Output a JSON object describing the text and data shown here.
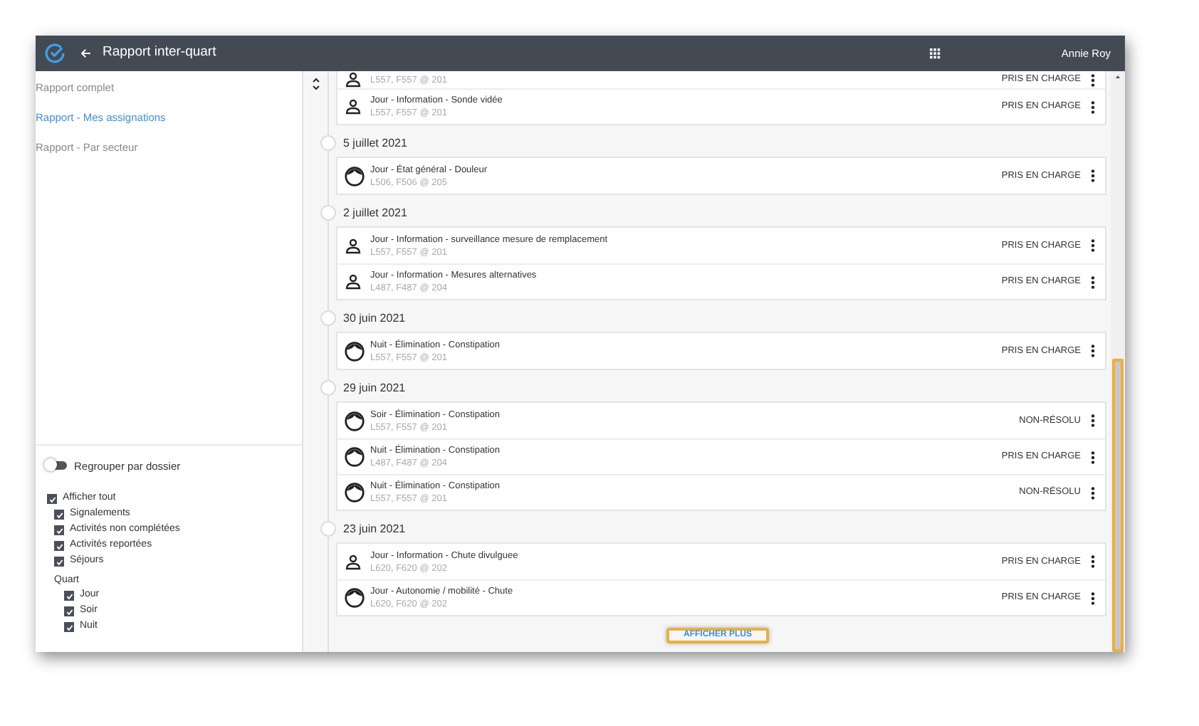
{
  "header": {
    "title": "Rapport inter-quart",
    "user": "Annie Roy"
  },
  "nav": [
    {
      "label": "Rapport complet",
      "selected": false
    },
    {
      "label": "Rapport - Mes assignations",
      "selected": true
    },
    {
      "label": "Rapport - Par secteur",
      "selected": false
    }
  ],
  "group_toggle": {
    "label": "Regrouper par dossier",
    "on": false
  },
  "filters": {
    "label": "Afficher tout",
    "checked": true,
    "children": [
      {
        "label": "Signalements",
        "checked": true
      },
      {
        "label": "Activités non complétées",
        "checked": true
      },
      {
        "label": "Activités reportées",
        "checked": true
      },
      {
        "label": "Séjours",
        "checked": true
      }
    ]
  },
  "shift": {
    "label": "Quart",
    "options": [
      {
        "label": "Jour",
        "checked": true
      },
      {
        "label": "Soir",
        "checked": true
      },
      {
        "label": "Nuit",
        "checked": true
      }
    ]
  },
  "timeline": [
    {
      "items": [
        {
          "kind": "person",
          "location": "L557, F557 @ 201",
          "status": "PRIS EN CHARGE"
        },
        {
          "kind": "person",
          "title": "Jour - Information - Sonde vidée",
          "location": "L557, F557 @ 201",
          "status": "PRIS EN CHARGE"
        }
      ]
    },
    {
      "date": "5 juillet 2021",
      "items": [
        {
          "kind": "face",
          "title": "Jour - État général - Douleur",
          "location": "L506, F506 @ 205",
          "status": "PRIS EN CHARGE"
        }
      ]
    },
    {
      "date": "2 juillet 2021",
      "items": [
        {
          "kind": "person",
          "title": "Jour - Information - surveillance mesure de remplacement",
          "location": "L557, F557 @ 201",
          "status": "PRIS EN CHARGE"
        },
        {
          "kind": "person",
          "title": "Jour - Information - Mesures alternatives",
          "location": "L487, F487 @ 204",
          "status": "PRIS EN CHARGE"
        }
      ]
    },
    {
      "date": "30 juin 2021",
      "items": [
        {
          "kind": "face",
          "title": "Nuit - Élimination - Constipation",
          "location": "L557, F557 @ 201",
          "status": "PRIS EN CHARGE"
        }
      ]
    },
    {
      "date": "29 juin 2021",
      "items": [
        {
          "kind": "face",
          "title": "Soir - Élimination - Constipation",
          "location": "L557, F557 @ 201",
          "status": "NON-RÉSOLU"
        },
        {
          "kind": "face",
          "title": "Nuit - Élimination - Constipation",
          "location": "L487, F487 @ 204",
          "status": "PRIS EN CHARGE"
        },
        {
          "kind": "face",
          "title": "Nuit - Élimination - Constipation",
          "location": "L557, F557 @ 201",
          "status": "NON-RÉSOLU"
        }
      ]
    },
    {
      "date": "23 juin 2021",
      "items": [
        {
          "kind": "person",
          "title": "Jour - Information - Chute divulguee",
          "location": "L620, F620 @ 202",
          "status": "PRIS EN CHARGE"
        },
        {
          "kind": "face",
          "title": "Jour - Autonomie / mobilité - Chute",
          "location": "L620, F620 @ 202",
          "status": "PRIS EN CHARGE"
        }
      ]
    }
  ],
  "more_button": "AFFICHER PLUS"
}
